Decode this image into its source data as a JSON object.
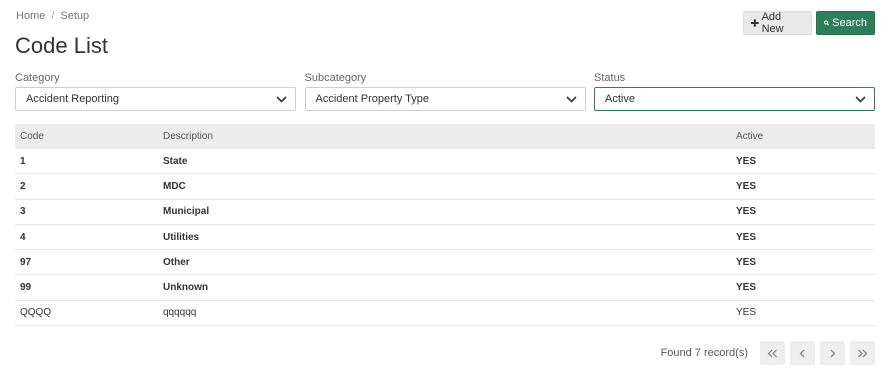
{
  "breadcrumb": {
    "home": "Home",
    "separator": "/",
    "current": "Setup"
  },
  "page_title": "Code List",
  "toolbar": {
    "add_label": "Add New",
    "search_label": "Search"
  },
  "filters": {
    "category": {
      "label": "Category",
      "value": "Accident Reporting"
    },
    "subcategory": {
      "label": "Subcategory",
      "value": "Accident Property Type"
    },
    "status": {
      "label": "Status",
      "value": "Active"
    }
  },
  "table": {
    "headers": {
      "code": "Code",
      "description": "Description",
      "active": "Active"
    },
    "rows": [
      {
        "code": "1",
        "description": "State",
        "active": "YES"
      },
      {
        "code": "2",
        "description": "MDC",
        "active": "YES"
      },
      {
        "code": "3",
        "description": "Municipal",
        "active": "YES"
      },
      {
        "code": "4",
        "description": "Utilities",
        "active": "YES"
      },
      {
        "code": "97",
        "description": "Other",
        "active": "YES"
      },
      {
        "code": "99",
        "description": "Unknown",
        "active": "YES"
      },
      {
        "code": "QQQQ",
        "description": "qqqqqq",
        "active": "YES"
      }
    ]
  },
  "pager": {
    "found_text": "Found 7 record(s)"
  },
  "colors": {
    "primary": "#2e7d5b",
    "header_bg": "#ececec"
  }
}
